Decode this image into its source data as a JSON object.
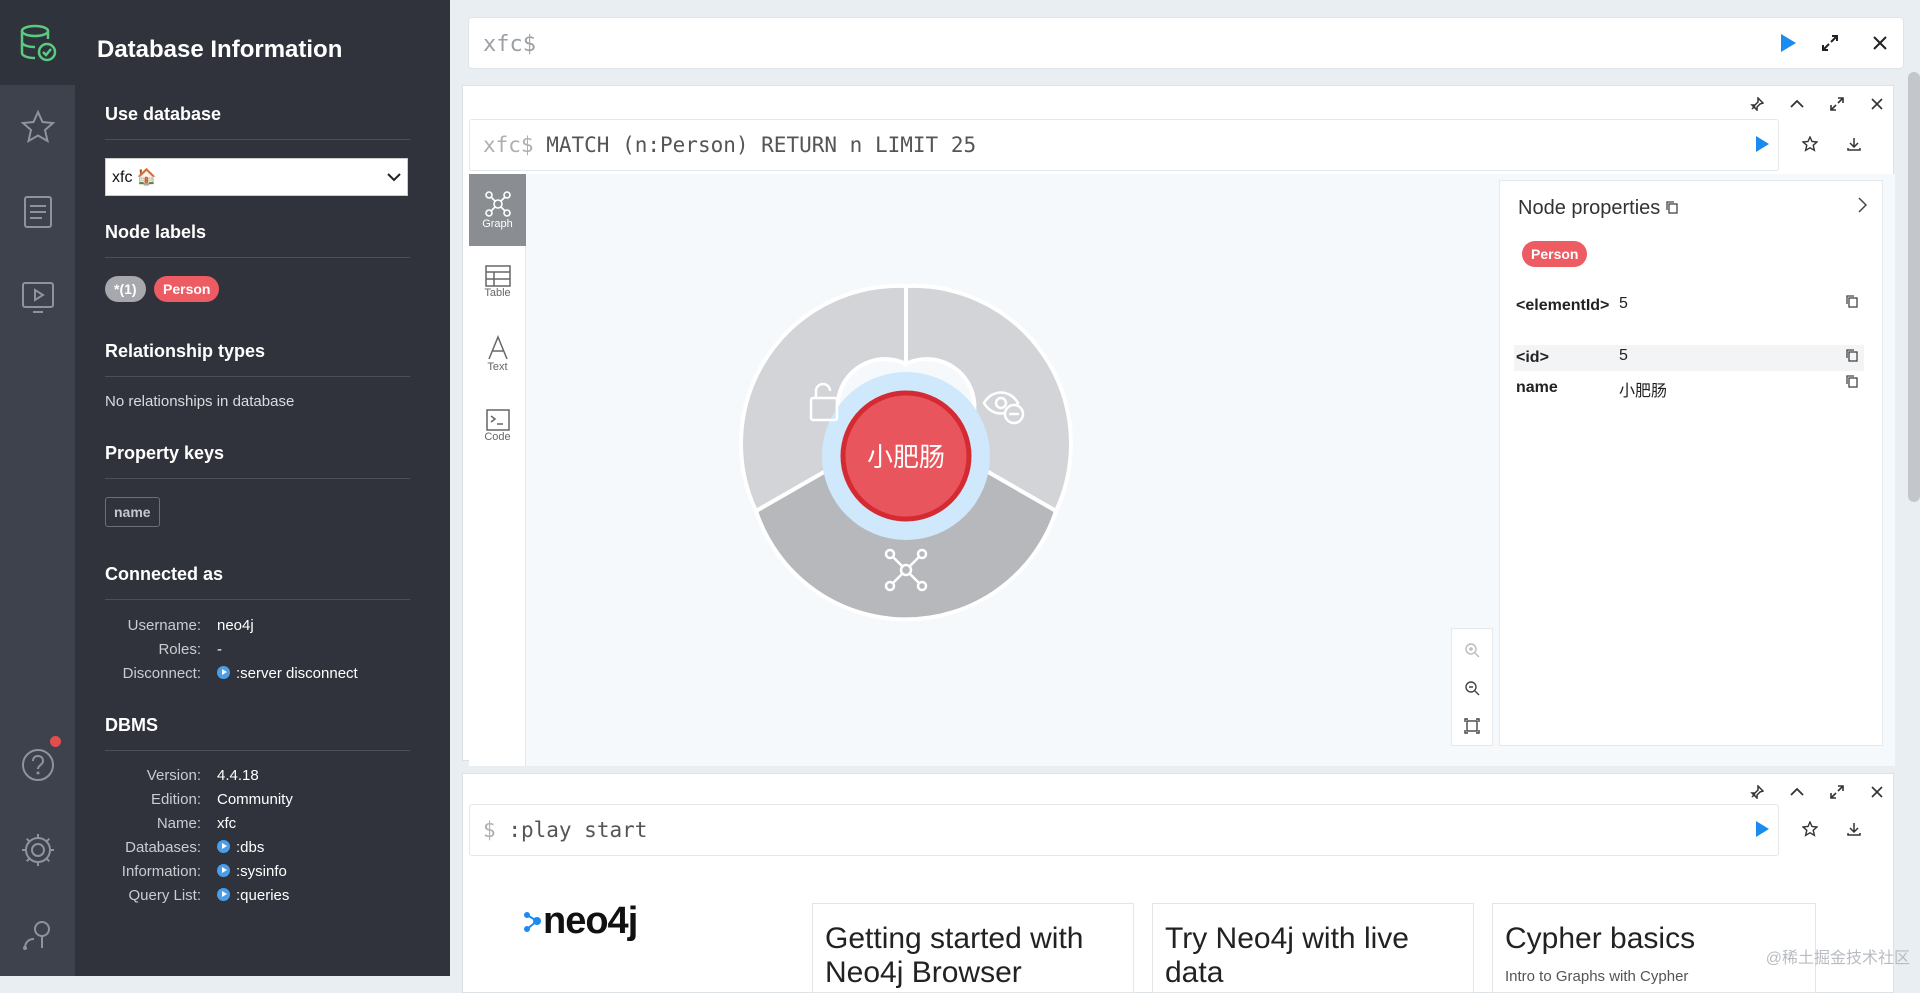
{
  "drawer": {
    "title": "Database Information",
    "use_database": {
      "heading": "Use database",
      "selected": "xfc 🏠"
    },
    "node_labels": {
      "heading": "Node labels",
      "all": "*(1)",
      "person": "Person"
    },
    "relationship_types": {
      "heading": "Relationship types",
      "empty": "No relationships in database"
    },
    "property_keys": {
      "heading": "Property keys",
      "keys": [
        "name"
      ]
    },
    "connected_as": {
      "heading": "Connected as",
      "username_label": "Username:",
      "username": "neo4j",
      "roles_label": "Roles:",
      "roles": "-",
      "disconnect_label": "Disconnect:",
      "disconnect": ":server disconnect"
    },
    "dbms": {
      "heading": "DBMS",
      "version_label": "Version:",
      "version": "4.4.18",
      "edition_label": "Edition:",
      "edition": "Community",
      "name_label": "Name:",
      "name": "xfc",
      "databases_label": "Databases:",
      "databases": ":dbs",
      "information_label": "Information:",
      "information": ":sysinfo",
      "querylist_label": "Query List:",
      "querylist": ":queries"
    }
  },
  "editor": {
    "prompt": "xfc$"
  },
  "frame1": {
    "prompt": "xfc$",
    "query": "MATCH (n:Person) RETURN n LIMIT 25",
    "tabs": [
      "Graph",
      "Table",
      "Text",
      "Code"
    ],
    "node_caption": "小肥肠",
    "properties": {
      "title": "Node properties",
      "label": "Person",
      "rows": [
        {
          "key": "<elementId>",
          "value": "5"
        },
        {
          "key": "<id>",
          "value": "5"
        },
        {
          "key": "name",
          "value": "小肥肠"
        }
      ]
    }
  },
  "frame2": {
    "prompt": "$",
    "query": ":play start",
    "logo": "neo4j",
    "cards": [
      "Getting started with Neo4j Browser",
      "Try Neo4j with live data",
      "Cypher basics"
    ],
    "card3_sub": "Intro to Graphs with Cypher"
  },
  "watermark": "@稀土掘金技术社区",
  "colors": {
    "person": "#ed5b63",
    "accent": "#1a8cf0",
    "drawer": "#30333b"
  }
}
